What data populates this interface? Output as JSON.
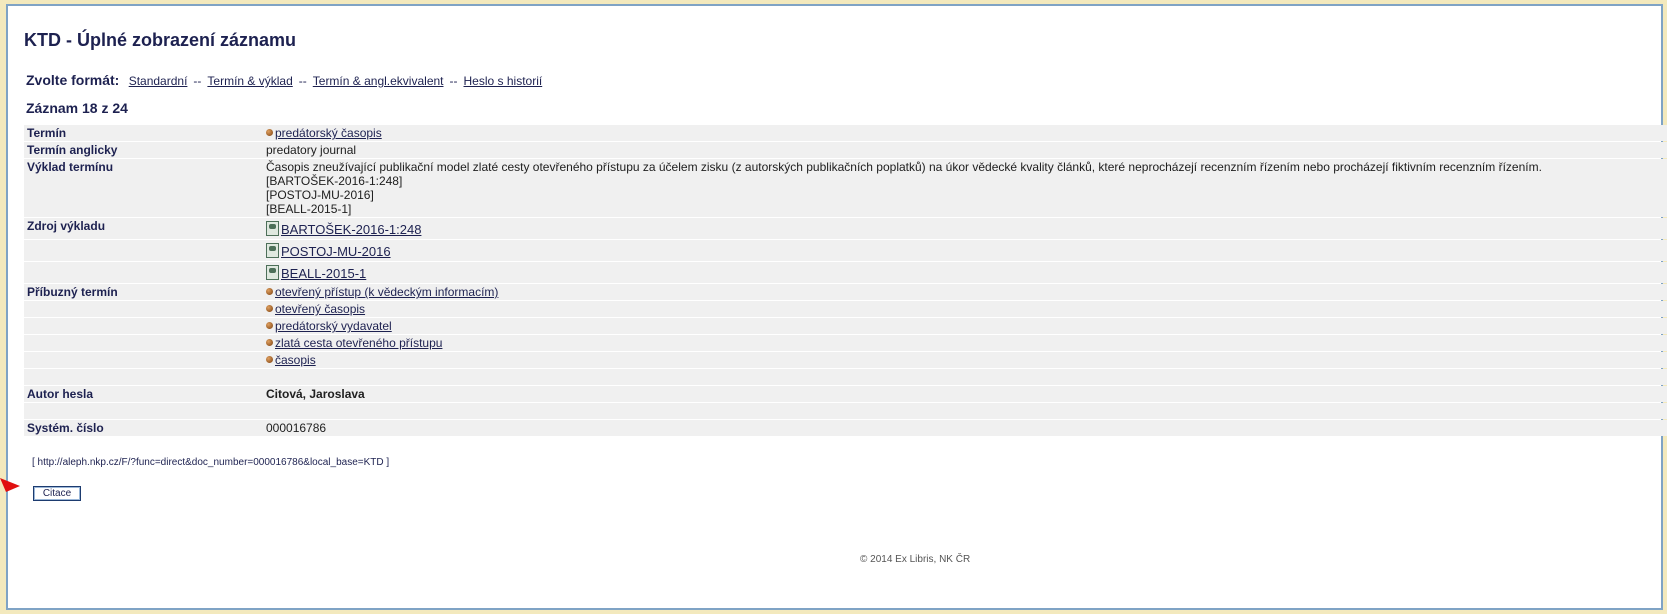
{
  "header": {
    "title": "KTD - Úplné zobrazení záznamu"
  },
  "format": {
    "label": "Zvolte formát:",
    "separator": "--",
    "options": [
      "Standardní",
      "Termín & výklad",
      "Termín & angl.ekvivalent",
      "Heslo s historií"
    ]
  },
  "record": {
    "count_text": "Záznam 18 z 24"
  },
  "fields": {
    "term": {
      "label": "Termín",
      "value": "predátorský časopis"
    },
    "term_en": {
      "label": "Termín anglicky",
      "value": "predatory journal"
    },
    "definition": {
      "label": "Výklad termínu",
      "text": "Časopis zneužívající publikační model zlaté cesty otevřeného přístupu za účelem zisku (z autorských publikačních poplatků) na úkor vědecké kvality článků, které neprocházejí recenzním řízením nebo procházejí fiktivním recenzním řízením.",
      "refs": [
        "[BARTOŠEK-2016-1:248]",
        "[POSTOJ-MU-2016]",
        "[BEALL-2015-1]"
      ]
    },
    "sources": {
      "label": "Zdroj výkladu",
      "items": [
        "BARTOŠEK-2016-1:248",
        "POSTOJ-MU-2016",
        "BEALL-2015-1"
      ]
    },
    "related": {
      "label": "Příbuzný termín",
      "items": [
        "otevřený přístup (k vědeckým informacím)",
        "otevřený časopis",
        "predátorský vydavatel",
        "zlatá cesta otevřeného přístupu",
        "časopis"
      ]
    },
    "author": {
      "label": "Autor hesla",
      "value": "Citová, Jaroslava"
    },
    "sysno": {
      "label": "Systém. číslo",
      "value": "000016786"
    }
  },
  "permalink": "[ http://aleph.nkp.cz/F/?func=direct&doc_number=000016786&local_base=KTD ]",
  "buttons": {
    "cite": "Citace"
  },
  "footer": {
    "copyright": "© 2014 Ex Libris, NK ČR"
  },
  "colors": {
    "accent": "#1d2150",
    "frame_border": "#7fa3c5",
    "row_bg": "#f0f0f0",
    "outer_bg": "#f3e9bd",
    "arrow": "#e01010"
  },
  "icons": {
    "bullet": "brown-ball-icon",
    "source": "document-icon",
    "pointer": "red-arrow-icon"
  }
}
